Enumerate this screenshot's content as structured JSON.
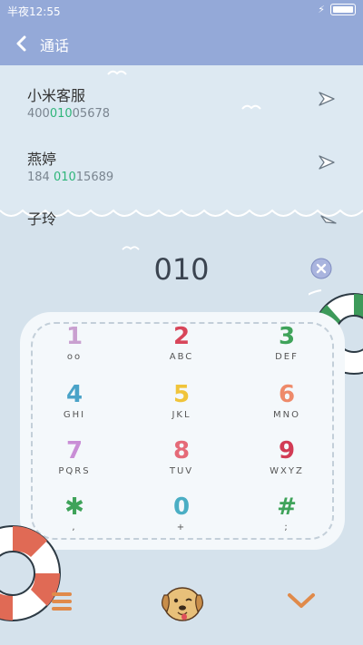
{
  "status_bar": {
    "time": "半夜12:55",
    "charge_icon": "lightning-icon",
    "battery_icon": "battery-icon"
  },
  "header": {
    "title": "通话",
    "back_icon": "chevron-left-icon"
  },
  "contacts": [
    {
      "name": "小米客服",
      "number_pre": "400",
      "number_match": "010",
      "number_post": "05678"
    },
    {
      "name": "燕婷",
      "number_pre": "184 ",
      "number_match": "010",
      "number_post": "15689"
    },
    {
      "name": "子玲"
    }
  ],
  "dialer": {
    "input": "010",
    "clear_icon": "clear-icon"
  },
  "keypad": [
    {
      "digit": "1",
      "letters": "oo",
      "color": "#c9a0d0"
    },
    {
      "digit": "2",
      "letters": "ABC",
      "color": "#d8465a"
    },
    {
      "digit": "3",
      "letters": "DEF",
      "color": "#3fa35a"
    },
    {
      "digit": "4",
      "letters": "GHI",
      "color": "#4aa3c8"
    },
    {
      "digit": "5",
      "letters": "JKL",
      "color": "#f0c43a"
    },
    {
      "digit": "6",
      "letters": "MNO",
      "color": "#ee8a6a"
    },
    {
      "digit": "7",
      "letters": "PQRS",
      "color": "#c98ed6"
    },
    {
      "digit": "8",
      "letters": "TUV",
      "color": "#e56a78"
    },
    {
      "digit": "9",
      "letters": "WXYZ",
      "color": "#d23b55"
    },
    {
      "digit": "✱",
      "letters": ",",
      "color": "#3fa35a"
    },
    {
      "digit": "0",
      "letters": "+",
      "color": "#4aaec4"
    },
    {
      "digit": "#",
      "letters": ";",
      "color": "#3fa35a"
    }
  ],
  "bottom_bar": {
    "menu_icon": "menu-icon",
    "center_icon": "dog-face-icon",
    "collapse_icon": "chevron-down-icon"
  },
  "colors": {
    "header": "#94a9d8",
    "highlight": "#2fb57a",
    "background": "#d5e2ec"
  }
}
